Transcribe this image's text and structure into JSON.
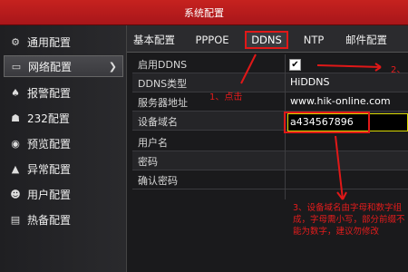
{
  "window": {
    "title": "系统配置"
  },
  "sidebar": {
    "items": [
      {
        "label": "通用配置",
        "icon": "gear-icon"
      },
      {
        "label": "网络配置",
        "icon": "network-icon",
        "active": true
      },
      {
        "label": "报警配置",
        "icon": "bell-icon"
      },
      {
        "label": "232配置",
        "icon": "serial-icon"
      },
      {
        "label": "预览配置",
        "icon": "eye-icon"
      },
      {
        "label": "异常配置",
        "icon": "warning-icon"
      },
      {
        "label": "用户配置",
        "icon": "users-icon"
      },
      {
        "label": "热备配置",
        "icon": "backup-icon"
      }
    ]
  },
  "tabs": [
    {
      "label": "基本配置"
    },
    {
      "label": "PPPOE"
    },
    {
      "label": "DDNS",
      "active": true
    },
    {
      "label": "NTP"
    },
    {
      "label": "邮件配置"
    }
  ],
  "form": {
    "rows": [
      {
        "label": "启用DDNS",
        "value": ""
      },
      {
        "label": "DDNS类型",
        "value": "HiDDNS"
      },
      {
        "label": "服务器地址",
        "value": "www.hik-online.com"
      },
      {
        "label": "设备域名",
        "value": "a434567896"
      },
      {
        "label": "用户名",
        "value": ""
      },
      {
        "label": "密码",
        "value": ""
      },
      {
        "label": "确认密码",
        "value": ""
      }
    ],
    "enable_checked": true
  },
  "annotations": {
    "step1": "1、点击",
    "step2": "2、",
    "step3": "3、设备域名由字母和数字组成，字母需小写，部分前缀不能为数字，建议勿修改"
  },
  "colors": {
    "accent": "#e01818",
    "titlebar": "#b51c1c"
  }
}
